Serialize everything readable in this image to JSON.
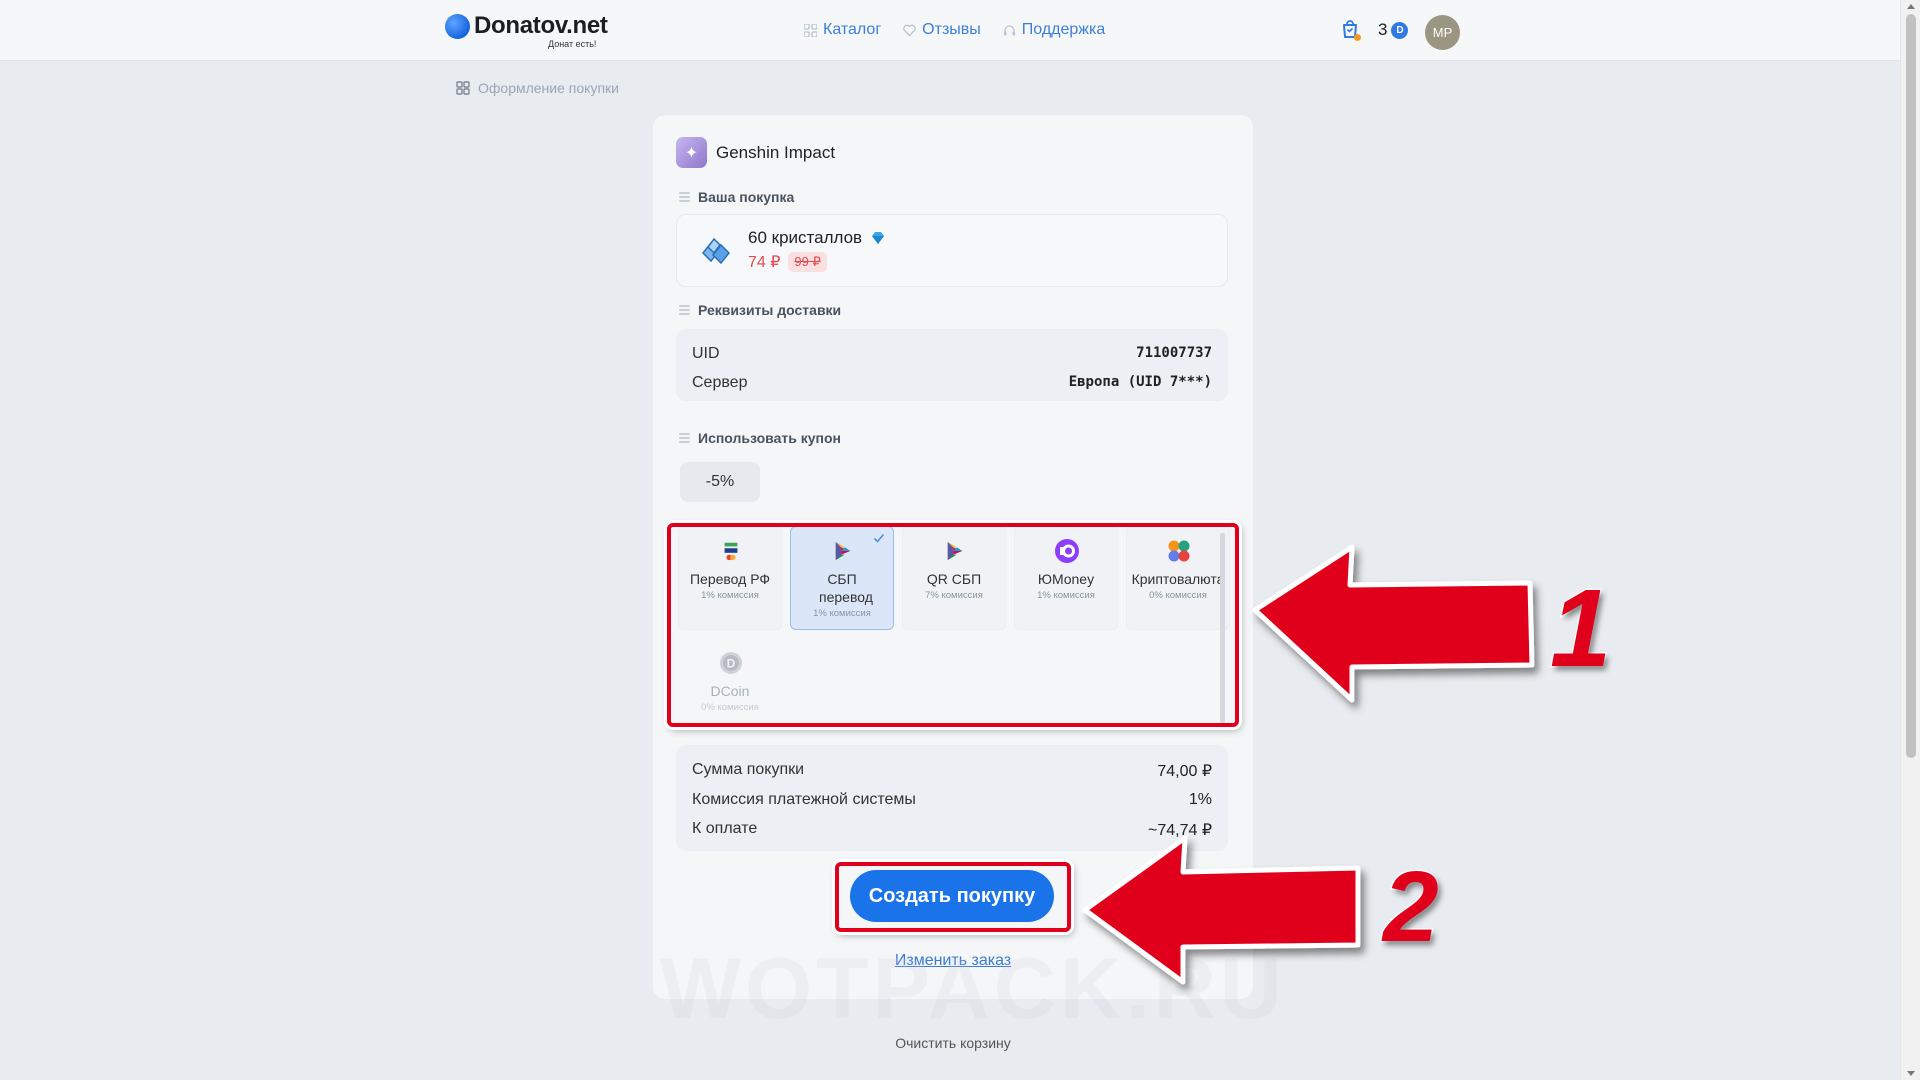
{
  "header": {
    "logo_text": "Donatov.net",
    "logo_tagline": "Донат есть!",
    "nav": [
      {
        "label": "Каталог",
        "icon": "grid-icon"
      },
      {
        "label": "Отзывы",
        "icon": "heart-icon"
      },
      {
        "label": "Поддержка",
        "icon": "headset-icon"
      }
    ],
    "balance": "3",
    "coin_symbol": "D",
    "avatar_initials": "MP"
  },
  "breadcrumb": {
    "current": "Оформление покупки"
  },
  "game": {
    "title": "Genshin Impact"
  },
  "purchase": {
    "section_label": "Ваша покупка",
    "product_name": "60 кристаллов",
    "price": "74 ₽",
    "old_price": "99 ₽"
  },
  "delivery": {
    "section_label": "Реквизиты доставки",
    "uid_label": "UID",
    "uid_value": "711007737",
    "server_label": "Сервер",
    "server_value": "Европа (UID 7***)"
  },
  "coupon": {
    "section_label": "Использовать купон",
    "value": "-5%"
  },
  "payment_methods": [
    {
      "name": "Перевод РФ",
      "fee": "1% комиссия",
      "icon": "bank-card-icon",
      "selected": false,
      "disabled": false
    },
    {
      "name": "СБП перевод",
      "fee": "1% комиссия",
      "icon": "sbp-icon",
      "selected": true,
      "disabled": false
    },
    {
      "name": "QR СБП",
      "fee": "7% комиссия",
      "icon": "sbp-qr-icon",
      "selected": false,
      "disabled": false
    },
    {
      "name": "ЮMoney",
      "fee": "1% комиссия",
      "icon": "yoomoney-icon",
      "selected": false,
      "disabled": false
    },
    {
      "name": "Криптовалюта",
      "fee": "0% комиссия",
      "icon": "crypto-icon",
      "selected": false,
      "disabled": false
    },
    {
      "name": "DCoin",
      "fee": "0% комиссия",
      "icon": "dcoin-icon",
      "selected": false,
      "disabled": true
    }
  ],
  "summary": {
    "sum_label": "Сумма покупки",
    "sum_value": "74,00 ₽",
    "fee_label": "Комиссия платежной системы",
    "fee_value": "1%",
    "total_label": "К оплате",
    "total_value": "~74,74 ₽"
  },
  "actions": {
    "create_label": "Создать покупку",
    "change_label": "Изменить заказ",
    "clear_label": "Очистить корзину"
  },
  "annotations": {
    "step1": "1",
    "step2": "2",
    "color": "#e0001b"
  },
  "watermark": "WOTPACK.RU",
  "colors": {
    "accent": "#1a73e8",
    "price": "#e5484d",
    "background": "#e8ebef"
  }
}
